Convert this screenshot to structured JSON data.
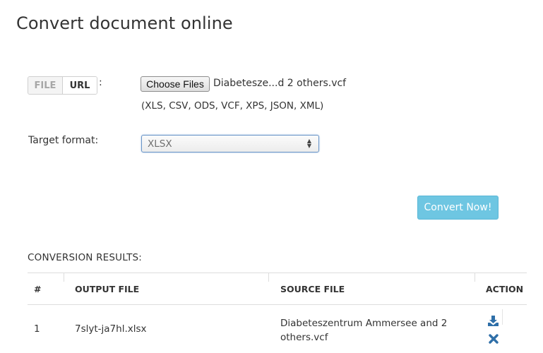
{
  "header": {
    "title": "Convert document online"
  },
  "source_toggle": {
    "file_label": "FILE",
    "url_label": "URL",
    "separator": ":"
  },
  "file_input": {
    "button_label": "Choose Files",
    "chosen_text": "Diabetesze...d 2 others.vcf",
    "formats_hint": "(XLS, CSV, ODS, VCF, XPS, JSON, XML)"
  },
  "target": {
    "label": "Target format:",
    "selected": "XLSX"
  },
  "convert_button": {
    "label": "Convert Now!"
  },
  "results": {
    "title": "CONVERSION RESULTS:",
    "columns": {
      "num": "#",
      "output": "OUTPUT FILE",
      "source": "SOURCE FILE",
      "action": "ACTION"
    },
    "rows": [
      {
        "num": "1",
        "output_file": "7slyt-ja7hl.xlsx",
        "source_line1": "Diabeteszentrum Ammersee and 2",
        "source_line2": "others.vcf"
      }
    ]
  },
  "icons": {
    "download": "download-icon",
    "delete": "close-icon",
    "select_arrows": "select-arrows-icon"
  },
  "colors": {
    "accent": "#6ec6e2",
    "link": "#2a7ab8",
    "icon": "#2f6fa8"
  }
}
